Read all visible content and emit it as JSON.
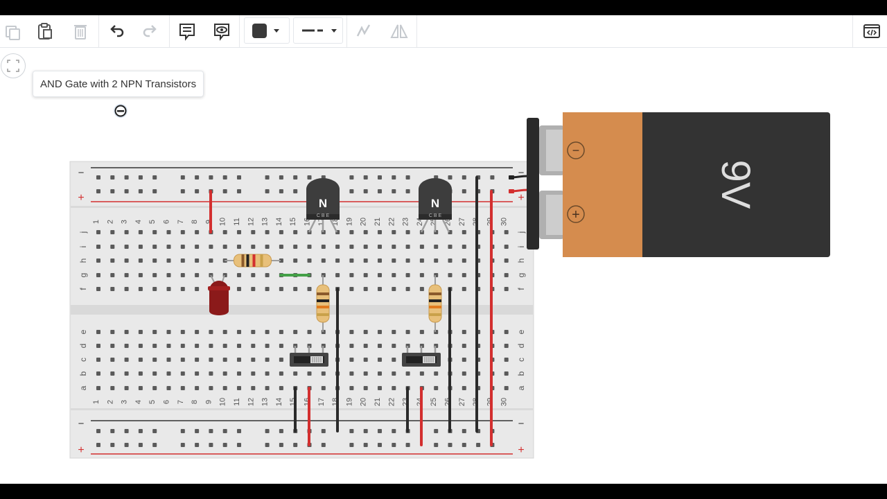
{
  "toolbar": {
    "tools": [
      {
        "name": "copy-icon"
      },
      {
        "name": "paste-icon"
      },
      {
        "name": "delete-icon"
      },
      {
        "name": "undo-icon"
      },
      {
        "name": "redo-icon"
      },
      {
        "name": "notes-icon"
      },
      {
        "name": "view-icon"
      },
      {
        "name": "fill-color-icon"
      },
      {
        "name": "line-style-icon"
      },
      {
        "name": "rotate-icon"
      },
      {
        "name": "flip-icon"
      },
      {
        "name": "code-icon"
      }
    ],
    "fill_color": "#3a3a3a"
  },
  "tooltip": {
    "label": "AND Gate with 2 NPN Transistors"
  },
  "breadboard": {
    "rail_minus": "−",
    "rail_plus": "+",
    "columns": [
      "1",
      "2",
      "3",
      "4",
      "5",
      "6",
      "7",
      "8",
      "9",
      "10",
      "11",
      "12",
      "13",
      "14",
      "15",
      "16",
      "17",
      "18",
      "19",
      "20",
      "21",
      "22",
      "23",
      "24",
      "25",
      "26",
      "27",
      "28",
      "29",
      "30"
    ],
    "rows_top": [
      "j",
      "i",
      "h",
      "g",
      "f"
    ],
    "rows_bottom": [
      "e",
      "d",
      "c",
      "b",
      "a"
    ]
  },
  "transistors": [
    {
      "label": "N",
      "pins": "C B E"
    },
    {
      "label": "N",
      "pins": "C B E"
    }
  ],
  "battery": {
    "voltage": "9V",
    "minus": "−",
    "plus": "+",
    "body_color": "#333333",
    "cap_color": "#d58c4e"
  },
  "colors": {
    "wire_red": "#d32f2f",
    "wire_black": "#2b2b2b",
    "wire_green": "#43a047",
    "led": "#8b1a1a",
    "rail_red": "#d32f2f"
  }
}
